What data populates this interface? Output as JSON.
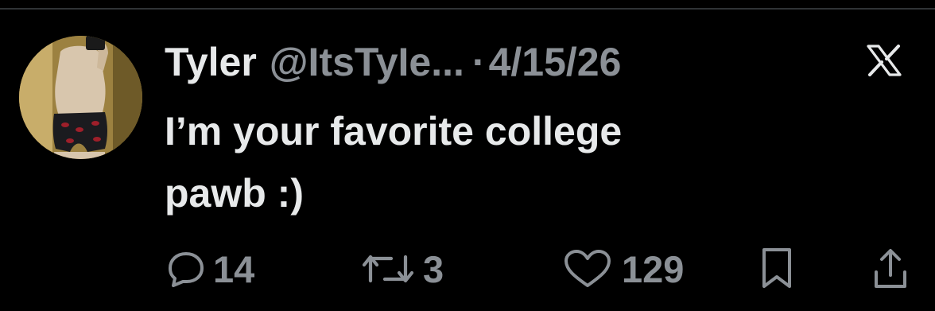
{
  "tweet": {
    "author_name": "Tyler",
    "author_handle": "@ItsTyIe...",
    "separator": "·",
    "date": "4/15/26",
    "text_line1": "I’m your favorite college",
    "text_line2": "pawb :)"
  },
  "actions": {
    "reply_count": "14",
    "retweet_count": "3",
    "like_count": "129"
  },
  "colors": {
    "background": "#000000",
    "primary_text": "#e7e9ea",
    "secondary_text": "#8b9096",
    "divider": "#2f3336"
  },
  "icons": [
    "x-logo-icon",
    "reply-icon",
    "retweet-icon",
    "like-icon",
    "bookmark-icon",
    "share-icon"
  ]
}
